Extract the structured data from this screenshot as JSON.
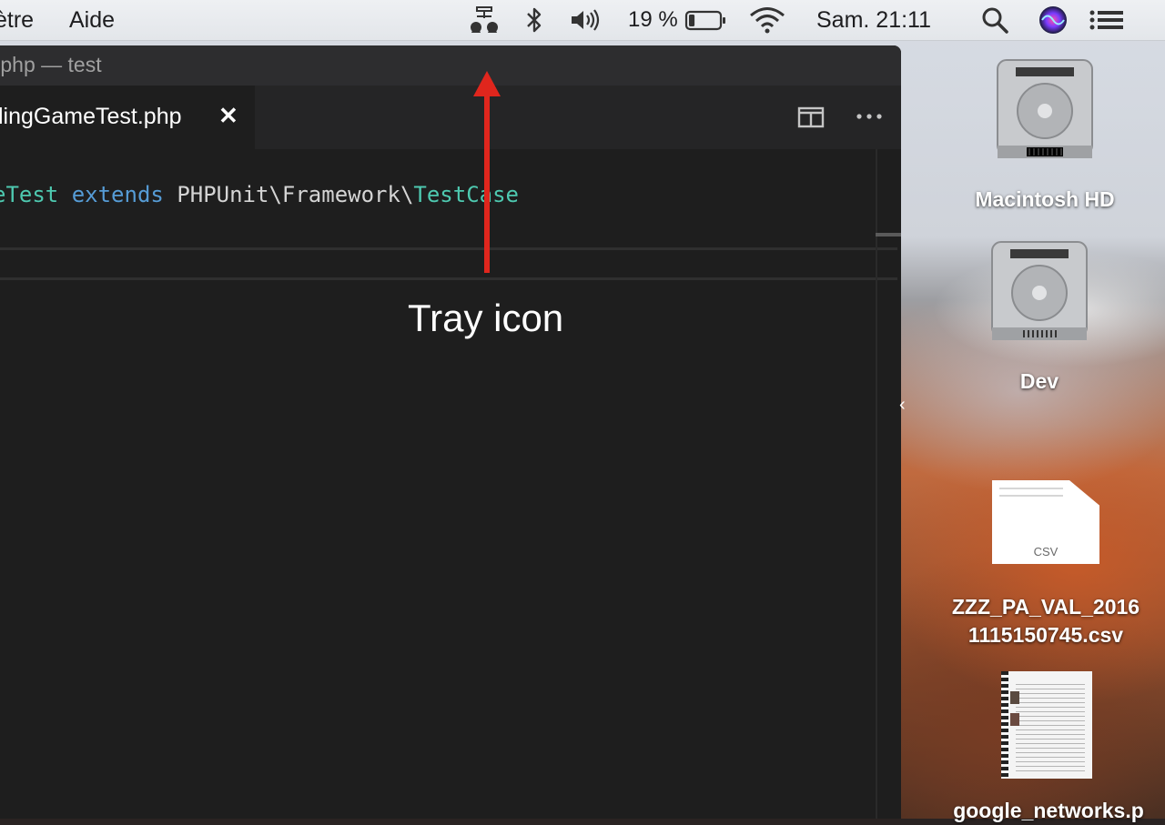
{
  "menubar": {
    "menus": [
      "ètre",
      "Aide"
    ],
    "status": {
      "presenter_icon": "presenter-tray-icon",
      "bluetooth_icon": "bluetooth-icon",
      "volume_icon": "volume-icon",
      "battery_percent": "19 %",
      "battery_level": 0.19,
      "wifi_icon": "wifi-icon",
      "clock": "Sam. 21:11",
      "search_icon": "spotlight-icon",
      "siri_icon": "siri-icon",
      "notification_icon": "notification-center-icon"
    }
  },
  "editor": {
    "window_title": ".php — test",
    "tab_label": "lingGameTest.php",
    "tab_close": "✕",
    "split_icon": "split-editor-icon",
    "more_icon": "more-actions-icon",
    "code": {
      "class_fragment": "eTest",
      "keyword": "extends",
      "namespace": "PHPUnit\\Framework\\",
      "parent_class": "TestCase"
    }
  },
  "annotation": {
    "label": "Tray icon",
    "arrow_color": "#e0261d"
  },
  "desktop": {
    "icons": [
      {
        "label": "Macintosh HD",
        "type": "hard-drive"
      },
      {
        "label": "Dev",
        "type": "hard-drive"
      },
      {
        "label_line1": "ZZZ_PA_VAL_2016",
        "label_line2": "1115150745.csv",
        "type": "csv-file",
        "ext": "CSV"
      },
      {
        "label": "google_networks.p",
        "type": "pdf-file"
      }
    ]
  }
}
